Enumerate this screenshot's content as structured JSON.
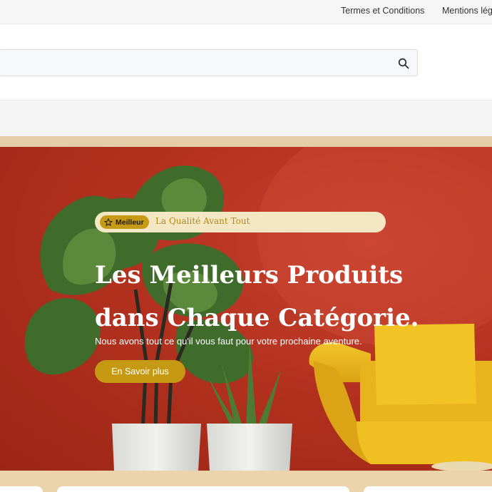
{
  "topbar": {
    "links": [
      "Termes et Conditions",
      "Mentions légales"
    ]
  },
  "search": {
    "placeholder": "",
    "icon": "search-icon"
  },
  "hero": {
    "badge_label": "Meilleur",
    "badge_icon": "star-icon",
    "tagline": "La Qualité Avant Tout",
    "title_line1": "Les Meilleurs Produits",
    "title_line2": "dans Chaque Catégorie.",
    "subtitle": "Nous avons tout ce qu'il vous faut pour votre prochaine aventure.",
    "cta_label": "En Savoir plus"
  },
  "colors": {
    "accent": "#c59a12",
    "hero_bg": "#b3321f",
    "pill_bg": "#f3e7c4",
    "tan": "#e4cda7"
  }
}
